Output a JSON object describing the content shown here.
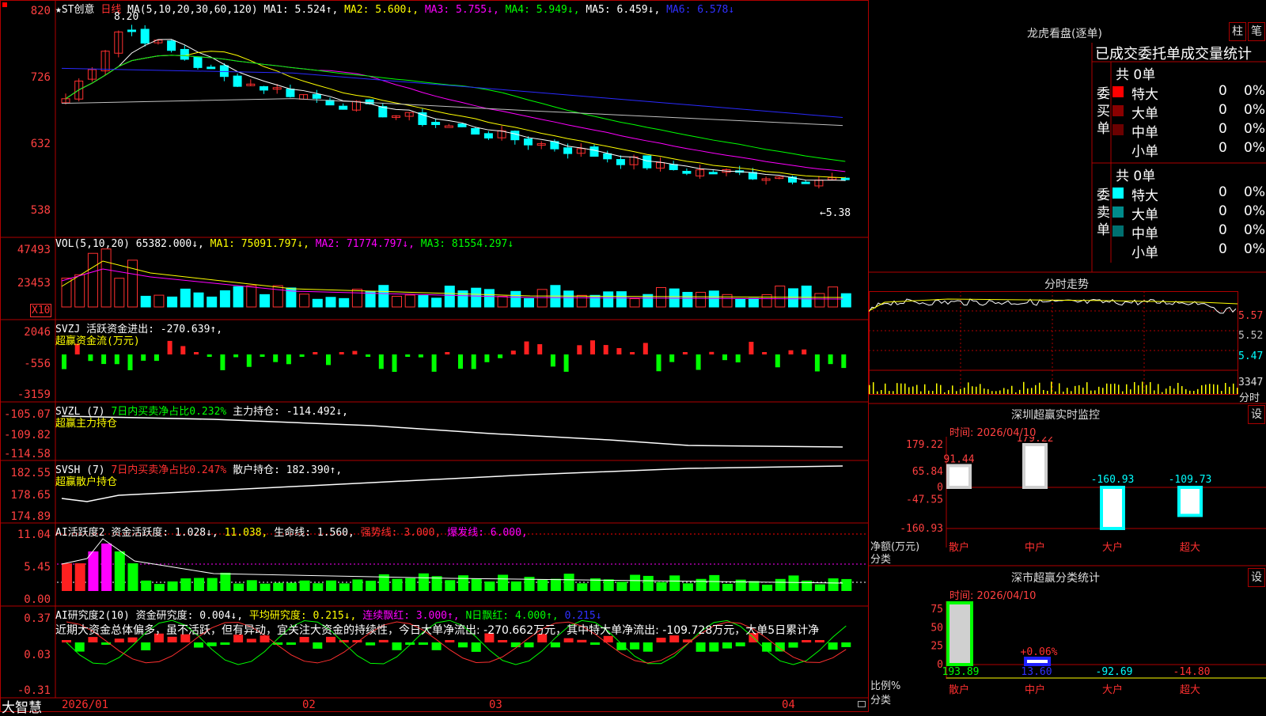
{
  "app_name": "大智慧",
  "main_chart": {
    "header": {
      "title": "★ST创意",
      "period": "日线",
      "ma_def": "MA(5,10,20,30,60,120)",
      "ma1": "MA1: 5.524↑,",
      "ma2": "MA2: 5.600↓,",
      "ma3": "MA3: 5.755↓,",
      "ma4": "MA4: 5.949↓,",
      "ma5": "MA5: 6.459↓,",
      "ma6": "MA6: 6.578↓"
    },
    "axis": [
      "820",
      "726",
      "632",
      "538"
    ],
    "high_marker": "8.20",
    "low_marker": "←5.38"
  },
  "vol_panel": {
    "header": {
      "name": "VOL(5,10,20)",
      "val": "65382.000↓,",
      "ma1": "MA1: 75091.797↓,",
      "ma2": "MA2: 71774.797↓,",
      "ma3": "MA3: 81554.297↓"
    },
    "axis": [
      "47493",
      "23453"
    ],
    "unit": "X10"
  },
  "svzj_panel": {
    "header": {
      "name": "SVZJ",
      "label": "活跃资金进出: -270.639↑,",
      "sub": "超赢资金流(万元)"
    },
    "axis": [
      "2046",
      "-556",
      "-3159"
    ]
  },
  "svzl_panel": {
    "header": {
      "name": "SVZL (7)",
      "ratio": "7日内买卖净占比0.232%",
      "hold": "主力持仓: -114.492↓,",
      "sub": "超赢主力持仓"
    },
    "axis": [
      "-105.07",
      "-109.82",
      "-114.58"
    ]
  },
  "svsh_panel": {
    "header": {
      "name": "SVSH (7)",
      "ratio": "7日内买卖净占比0.247%",
      "hold": "散户持仓: 182.390↑,",
      "sub": "超赢散户持仓"
    },
    "axis": [
      "182.55",
      "178.65",
      "174.89"
    ]
  },
  "ai_active_panel": {
    "header": {
      "name": "AI活跃度2",
      "fund": "资金活跃度: 1.028↓,",
      "v2": "11.038,",
      "life": "生命线: 1.560,",
      "strong": "强势线: 3.000,",
      "burst": "爆发线: 6.000,"
    },
    "axis": [
      "11.04",
      "5.45",
      "0.00"
    ]
  },
  "ai_research_panel": {
    "header": {
      "name": "AI研究度2(10)",
      "fund": "资金研究度: 0.004↓,",
      "avg": "平均研究度: 0.215↓,",
      "red": "连续飘红: 3.000↑,",
      "nred": "N日飘红: 4.000↑,",
      "v": "0.215↓"
    },
    "text": "近期大资金总体偏多，虽不活跃，但有异动，宜关注大资金的持续性，今日大单净流出: -270.662万元，其中特大单净流出: -109.728万元，大单5日累计净",
    "axis": [
      "0.37",
      "0.03",
      "-0.31"
    ]
  },
  "date_axis": [
    "2026/01",
    "02",
    "03",
    "04"
  ],
  "dragon": {
    "title": "龙虎看盘(逐单)",
    "btn1": "柱",
    "btn2": "笔",
    "stat_title": "已成交委托单成交量统计",
    "buy": {
      "side_label": "委买单",
      "total": "共 0单",
      "rows": [
        {
          "name": "特大",
          "count": "0",
          "pct": "0%",
          "color": "#ff0000"
        },
        {
          "name": "大单",
          "count": "0",
          "pct": "0%",
          "color": "#8b0000"
        },
        {
          "name": "中单",
          "count": "0",
          "pct": "0%",
          "color": "#6b0000"
        },
        {
          "name": "小单",
          "count": "0",
          "pct": "0%",
          "color": ""
        }
      ]
    },
    "sell": {
      "side_label": "委卖单",
      "total": "共 0单",
      "rows": [
        {
          "name": "特大",
          "count": "0",
          "pct": "0%",
          "color": "#00ffff"
        },
        {
          "name": "大单",
          "count": "0",
          "pct": "0%",
          "color": "#008b8b"
        },
        {
          "name": "中单",
          "count": "0",
          "pct": "0%",
          "color": "#007070"
        },
        {
          "name": "小单",
          "count": "0",
          "pct": "0%",
          "color": ""
        }
      ]
    }
  },
  "intraday": {
    "title": "分时走势",
    "axis": [
      "5.57",
      "5.52",
      "5.47"
    ],
    "vol_max": "3347",
    "vol_label": "分时"
  },
  "monitor": {
    "title": "深圳超赢实时监控",
    "btn": "设",
    "time": "时间: 2026/04/10",
    "axis": [
      "179.22",
      "65.84",
      "0",
      "-47.55",
      "-160.93"
    ],
    "ylabel": "净额(万元)",
    "xlabel": "分类",
    "chart_data": {
      "type": "bar",
      "categories": [
        "散户",
        "中户",
        "大户",
        "超大"
      ],
      "values": [
        91.44,
        179.22,
        -160.93,
        -109.73
      ],
      "value_labels": [
        "91.44",
        "179.22",
        "-160.93",
        "-109.73"
      ],
      "ylim": [
        -160.93,
        179.22
      ],
      "colors": [
        "#d0d0d0",
        "#d0d0d0",
        "#00ffff",
        "#00ffff"
      ]
    }
  },
  "classify": {
    "title": "深市超赢分类统计",
    "btn": "设",
    "time": "时间: 2026/04/10",
    "axis": [
      "75",
      "50",
      "25",
      "0"
    ],
    "ylabel": "比例%",
    "xlabel": "分类",
    "chart_data": {
      "type": "bar",
      "categories": [
        "散户",
        "中户",
        "大户",
        "超大"
      ],
      "values": [
        193.89,
        13.6,
        -92.69,
        -14.8
      ],
      "value_labels": [
        "193.89",
        "13.60",
        "-92.69",
        "-14.80"
      ],
      "bar_label": "+0.06%",
      "ylim": [
        0,
        75
      ]
    }
  }
}
